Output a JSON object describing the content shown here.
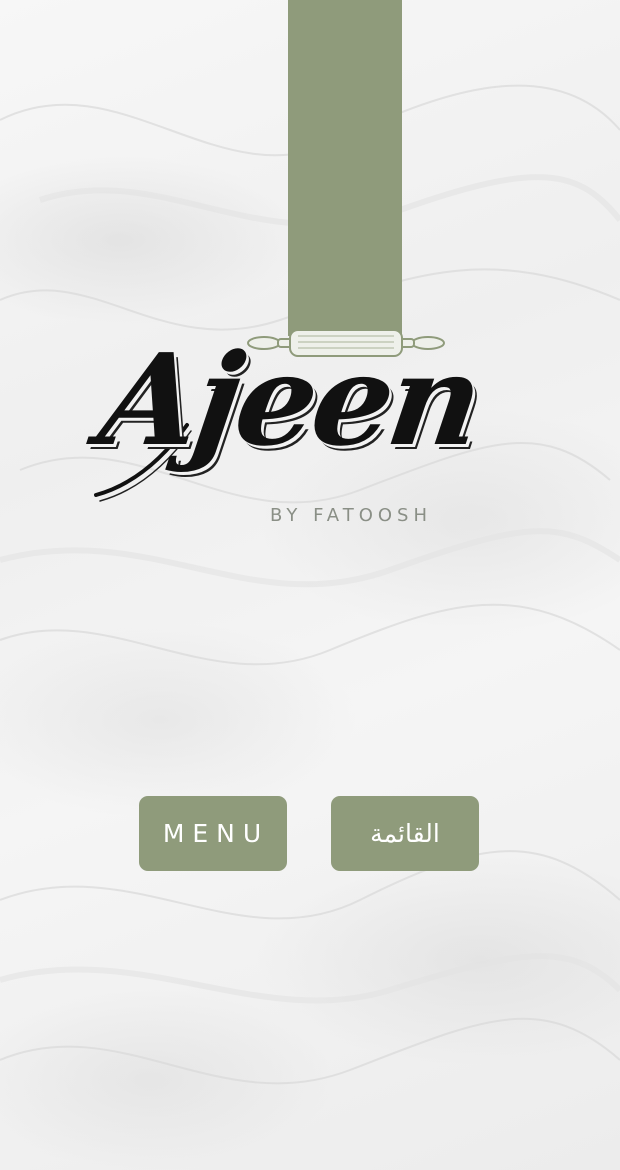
{
  "theme": {
    "accent": "#8f9b7b",
    "logo_ink": "#111111",
    "tagline_color": "#8a8f86"
  },
  "brand": {
    "name": "Ajeen",
    "tagline": "BY FATOOSH",
    "decoration_icon": "rolling-pin-icon"
  },
  "buttons": {
    "menu_en": "MENU",
    "menu_ar": "القائمة"
  }
}
